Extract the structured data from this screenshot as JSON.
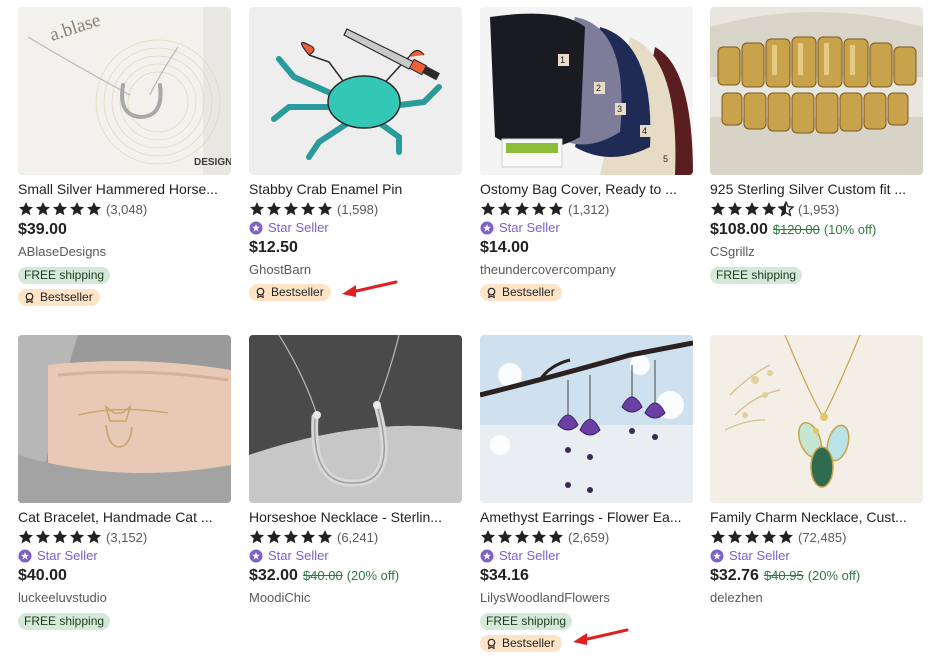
{
  "listings": [
    {
      "title": "Small Silver Hammered Horse...",
      "reviews": "(3,048)",
      "star_seller": "",
      "price": "$39.00",
      "original_price": "",
      "discount": "",
      "shop": "ABlaseDesigns",
      "free_shipping": "FREE shipping",
      "bestseller": "Bestseller",
      "rating": 5
    },
    {
      "title": "Stabby Crab Enamel Pin",
      "reviews": "(1,598)",
      "star_seller": "Star Seller",
      "price": "$12.50",
      "original_price": "",
      "discount": "",
      "shop": "GhostBarn",
      "free_shipping": "",
      "bestseller": "Bestseller",
      "rating": 5
    },
    {
      "title": "Ostomy Bag Cover, Ready to ...",
      "reviews": "(1,312)",
      "star_seller": "Star Seller",
      "price": "$14.00",
      "original_price": "",
      "discount": "",
      "shop": "theundercovercompany",
      "free_shipping": "",
      "bestseller": "Bestseller",
      "rating": 5
    },
    {
      "title": "925 Sterling Silver Custom fit ...",
      "reviews": "(1,953)",
      "star_seller": "",
      "price": "$108.00",
      "original_price": "$120.00",
      "discount": "(10% off)",
      "shop": "CSgrillz",
      "free_shipping": "FREE shipping",
      "bestseller": "",
      "rating": 4.5
    },
    {
      "title": "Cat Bracelet, Handmade Cat ...",
      "reviews": "(3,152)",
      "star_seller": "Star Seller",
      "price": "$40.00",
      "original_price": "",
      "discount": "",
      "shop": "luckeeluvstudio",
      "free_shipping": "FREE shipping",
      "bestseller": "",
      "rating": 5
    },
    {
      "title": "Horseshoe Necklace - Sterlin...",
      "reviews": "(6,241)",
      "star_seller": "Star Seller",
      "price": "$32.00",
      "original_price": "$40.00",
      "discount": "(20% off)",
      "shop": "MoodiChic",
      "free_shipping": "",
      "bestseller": "",
      "rating": 5
    },
    {
      "title": "Amethyst Earrings - Flower Ea...",
      "reviews": "(2,659)",
      "star_seller": "Star Seller",
      "price": "$34.16",
      "original_price": "",
      "discount": "",
      "shop": "LilysWoodlandFlowers",
      "free_shipping": "FREE shipping",
      "bestseller": "Bestseller",
      "rating": 5
    },
    {
      "title": "Family Charm Necklace, Cust...",
      "reviews": "(72,485)",
      "star_seller": "Star Seller",
      "price": "$32.76",
      "original_price": "$40.95",
      "discount": "(20% off)",
      "shop": "delezhen",
      "free_shipping": "",
      "bestseller": "",
      "rating": 5
    }
  ],
  "image_text": {
    "brand": "a.blase",
    "designs": "DESIGNS",
    "bag_numbers": [
      "1",
      "2",
      "3",
      "4",
      "5"
    ]
  },
  "colors": {
    "star": "#222222",
    "star_seller": "#7f60c9",
    "sale_green": "#2f7a3f",
    "free_shipping_bg": "#d4e9d7",
    "bestseller_bg": "#fde4c7",
    "annotation_arrow": "#e02020"
  }
}
